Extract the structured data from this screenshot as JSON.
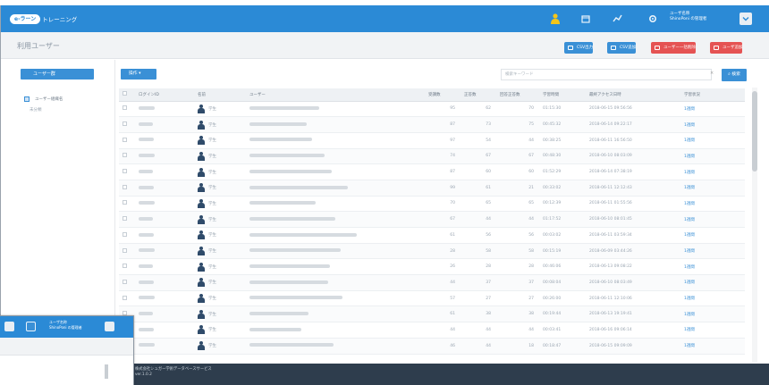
{
  "app": {
    "logo_badge": "e-ラーン",
    "logo_text": "トレーニング"
  },
  "topbar": {
    "user_name": "ユーザ名称",
    "user_sub": "ShinoPoni の管理者",
    "icons": [
      "user-icon",
      "calendar-icon",
      "chart-icon",
      "gear-icon"
    ]
  },
  "header": {
    "title": "利用ユーザー",
    "buttons": [
      {
        "label": "CSV出力",
        "color": "#3a90d6"
      },
      {
        "label": "CSV追加",
        "color": "#3a90d6"
      },
      {
        "label": "ユーザー一括削除",
        "color": "#e55353"
      },
      {
        "label": "ユーザ追加",
        "color": "#e55353"
      }
    ]
  },
  "sidebar": {
    "user_group_button": "ユーザー群",
    "tree": [
      {
        "label": "ユーザー組織名"
      },
      {
        "label": "未分類"
      }
    ]
  },
  "toolbar": {
    "operation_label": "操作",
    "search_placeholder": "検索キーワード",
    "search_button": "検索"
  },
  "table": {
    "columns": [
      "",
      "ログインID",
      "名前",
      "ユーザー",
      "受講数",
      "正答数",
      "回答正答数",
      "学習時間",
      "最終アクセス日時",
      "学習状況"
    ],
    "rows": [
      [
        "",
        "xxxxx",
        "学生",
        "",
        "95",
        "62",
        "70",
        "01:15:30",
        "2018-06-15 09:56:56",
        "1週間"
      ],
      [
        "",
        "xxxxx",
        "学生",
        "",
        "87",
        "73",
        "75",
        "00:45:32",
        "2018-06-14 09:22:17",
        "1週間"
      ],
      [
        "",
        "xxxxx",
        "学生",
        "",
        "97",
        "54",
        "44",
        "00:38:25",
        "2018-06-11 16:56:50",
        "1週間"
      ],
      [
        "",
        "xxxxx",
        "学生",
        "",
        "74",
        "67",
        "67",
        "00:48:30",
        "2018-06-10 08:03:09",
        "1週間"
      ],
      [
        "",
        "xxxxx",
        "学生",
        "",
        "87",
        "60",
        "60",
        "01:52:29",
        "2018-06-14 07:38:19",
        "1週間"
      ],
      [
        "",
        "xxxxx",
        "学生",
        "",
        "99",
        "61",
        "21",
        "00:33:02",
        "2018-06-11 12:12:43",
        "1週間"
      ],
      [
        "",
        "xxxxx",
        "学生",
        "",
        "70",
        "65",
        "65",
        "00:12:39",
        "2018-06-11 01:55:56",
        "1週間"
      ],
      [
        "",
        "xxxxx",
        "学生",
        "",
        "67",
        "44",
        "44",
        "01:17:52",
        "2018-06-10 08:01:45",
        "1週間"
      ],
      [
        "",
        "xxxxx",
        "学生",
        "",
        "61",
        "56",
        "56",
        "00:03:02",
        "2018-06-11 03:59:34",
        "1週間"
      ],
      [
        "",
        "xxxxx",
        "学生",
        "",
        "28",
        "58",
        "58",
        "00:15:19",
        "2018-06-09 03:44:26",
        "1週間"
      ],
      [
        "",
        "xxxxx",
        "学生",
        "",
        "26",
        "28",
        "28",
        "00:46:06",
        "2018-06-13 09:08:22",
        "1週間"
      ],
      [
        "",
        "xxxxx",
        "学生",
        "",
        "44",
        "37",
        "37",
        "00:08:04",
        "2018-06-10 08:03:49",
        "1週間"
      ],
      [
        "",
        "xxxxx",
        "学生",
        "",
        "57",
        "27",
        "27",
        "00:26:00",
        "2018-06-11 12:10:06",
        "1週間"
      ],
      [
        "",
        "xxxxx",
        "学生",
        "",
        "61",
        "38",
        "38",
        "00:19:44",
        "2018-06-13 19:19:41",
        "1週間"
      ],
      [
        "",
        "xxxxx",
        "学生",
        "",
        "44",
        "44",
        "44",
        "00:03:41",
        "2018-06-16 09:06:14",
        "1週間"
      ],
      [
        "",
        "xxxxx",
        "学生",
        "",
        "46",
        "44",
        "18",
        "00:18:47",
        "2018-06-15 09:09:09",
        "1週間"
      ]
    ]
  },
  "footer": {
    "line1": "株式会社シュガー学術データベースサービス",
    "line2": "ver.1.0.2"
  },
  "overlay": {
    "user_name": "ユーザ名称",
    "user_sub": "ShinoPoni の管理者"
  },
  "colors": {
    "primary": "#2b8ad6",
    "danger": "#e55353",
    "footer": "#2e3d4d"
  }
}
